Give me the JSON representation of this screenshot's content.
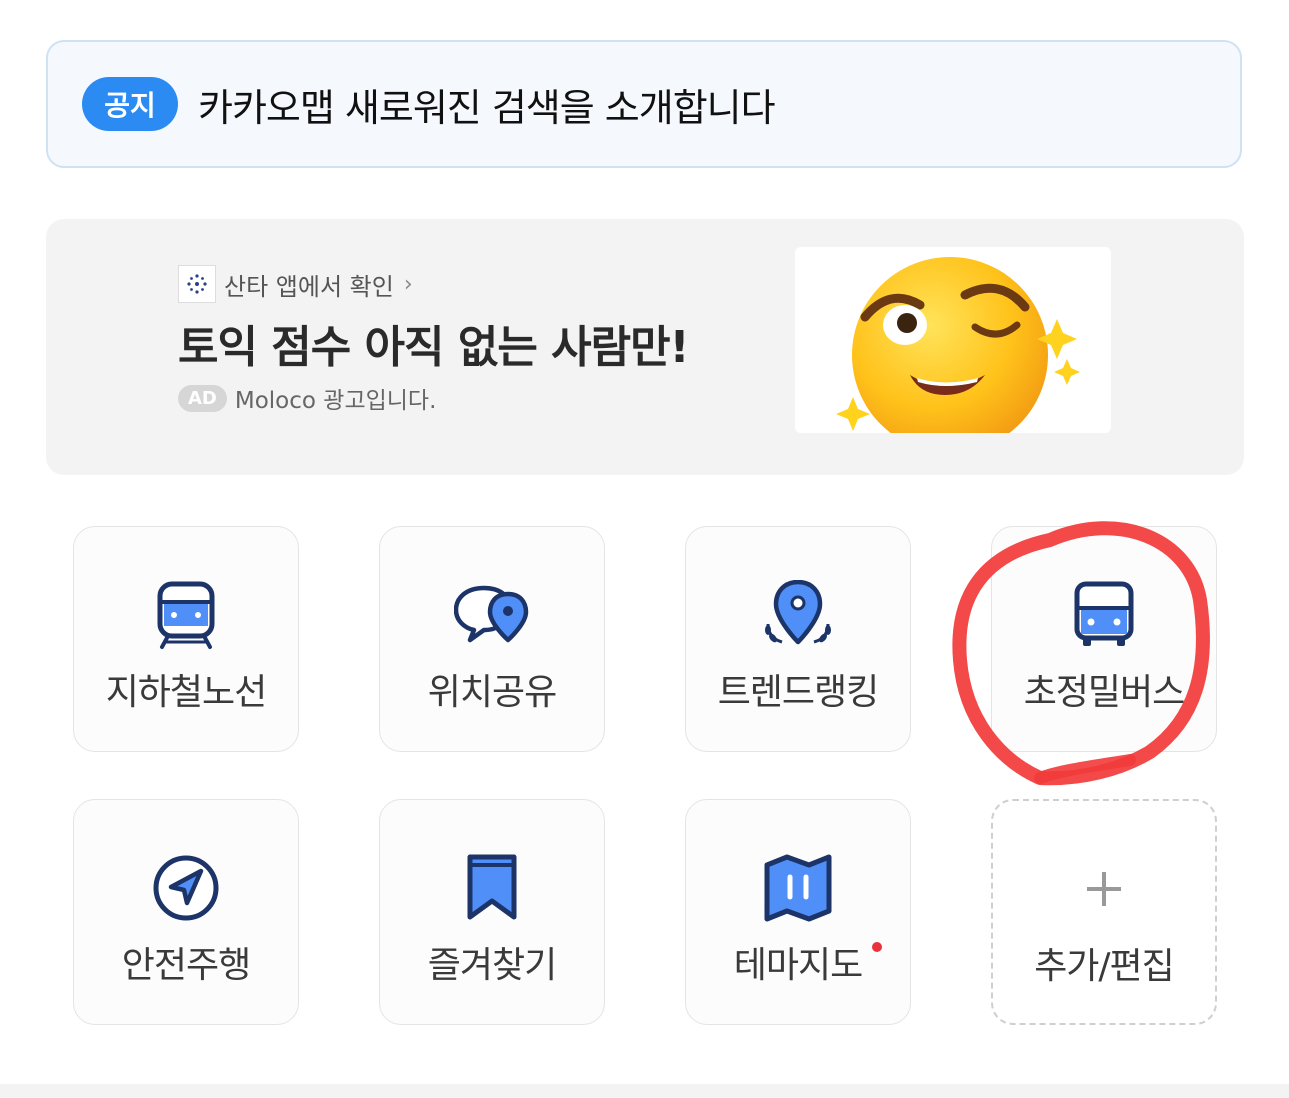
{
  "notice": {
    "badge": "공지",
    "text": "카카오맵 새로워진 검색을 소개합니다"
  },
  "ad": {
    "source": "산타 앱에서 확인",
    "headline": "토익 점수 아직 없는 사람만!",
    "tag": "AD",
    "advertiser": "Moloco 광고입니다."
  },
  "tiles": [
    {
      "label": "지하철노선",
      "icon": "subway-icon"
    },
    {
      "label": "위치공유",
      "icon": "location-share-icon"
    },
    {
      "label": "트렌드랭킹",
      "icon": "trend-ranking-icon"
    },
    {
      "label": "초정밀버스",
      "icon": "bus-icon"
    },
    {
      "label": "안전주행",
      "icon": "navigation-icon"
    },
    {
      "label": "즐겨찾기",
      "icon": "bookmark-icon"
    },
    {
      "label": "테마지도",
      "icon": "map-icon",
      "new_dot": true
    },
    {
      "label": "추가/편집",
      "icon": "plus-icon"
    }
  ],
  "colors": {
    "accent": "#2b8bf2",
    "icon_navy": "#1c3468",
    "icon_blue": "#4f8ff7",
    "annotation": "#f23a3a",
    "new_dot": "#e8323c"
  }
}
